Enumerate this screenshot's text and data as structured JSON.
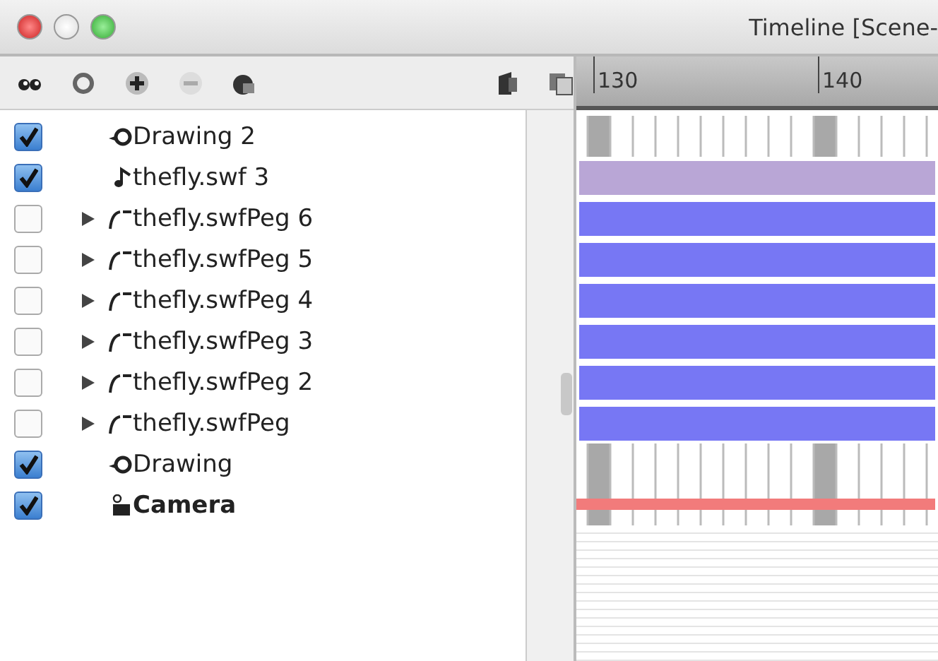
{
  "window": {
    "title": "Timeline [Scene-"
  },
  "ruler": {
    "labels": [
      "130",
      "140"
    ]
  },
  "layers": [
    {
      "name": "Drawing 2",
      "kind": "drawing",
      "checked": true,
      "bold": false,
      "track": {
        "kind": "frames"
      }
    },
    {
      "name": "thefly.swf 3",
      "kind": "sound",
      "checked": true,
      "bold": false,
      "track": {
        "kind": "bar",
        "color": "#b9a6d6"
      }
    },
    {
      "name": "thefly.swfPeg 6",
      "kind": "peg",
      "checked": false,
      "bold": false,
      "expanded": false,
      "track": {
        "kind": "bar",
        "color": "#7777f4"
      }
    },
    {
      "name": "thefly.swfPeg 5",
      "kind": "peg",
      "checked": false,
      "bold": false,
      "expanded": false,
      "track": {
        "kind": "bar",
        "color": "#7777f4"
      }
    },
    {
      "name": "thefly.swfPeg 4",
      "kind": "peg",
      "checked": false,
      "bold": false,
      "expanded": false,
      "track": {
        "kind": "bar",
        "color": "#7777f4"
      }
    },
    {
      "name": "thefly.swfPeg 3",
      "kind": "peg",
      "checked": false,
      "bold": false,
      "expanded": false,
      "track": {
        "kind": "bar",
        "color": "#7777f4"
      }
    },
    {
      "name": "thefly.swfPeg 2",
      "kind": "peg",
      "checked": false,
      "bold": false,
      "expanded": false,
      "track": {
        "kind": "bar",
        "color": "#7777f4"
      }
    },
    {
      "name": "thefly.swfPeg",
      "kind": "peg",
      "checked": false,
      "bold": false,
      "expanded": false,
      "track": {
        "kind": "bar",
        "color": "#7777f4"
      }
    },
    {
      "name": "Drawing",
      "kind": "drawing",
      "checked": true,
      "bold": false,
      "track": {
        "kind": "frames"
      }
    },
    {
      "name": "Camera",
      "kind": "camera",
      "checked": true,
      "bold": true,
      "track": {
        "kind": "line",
        "color": "#f27b7b"
      }
    }
  ]
}
